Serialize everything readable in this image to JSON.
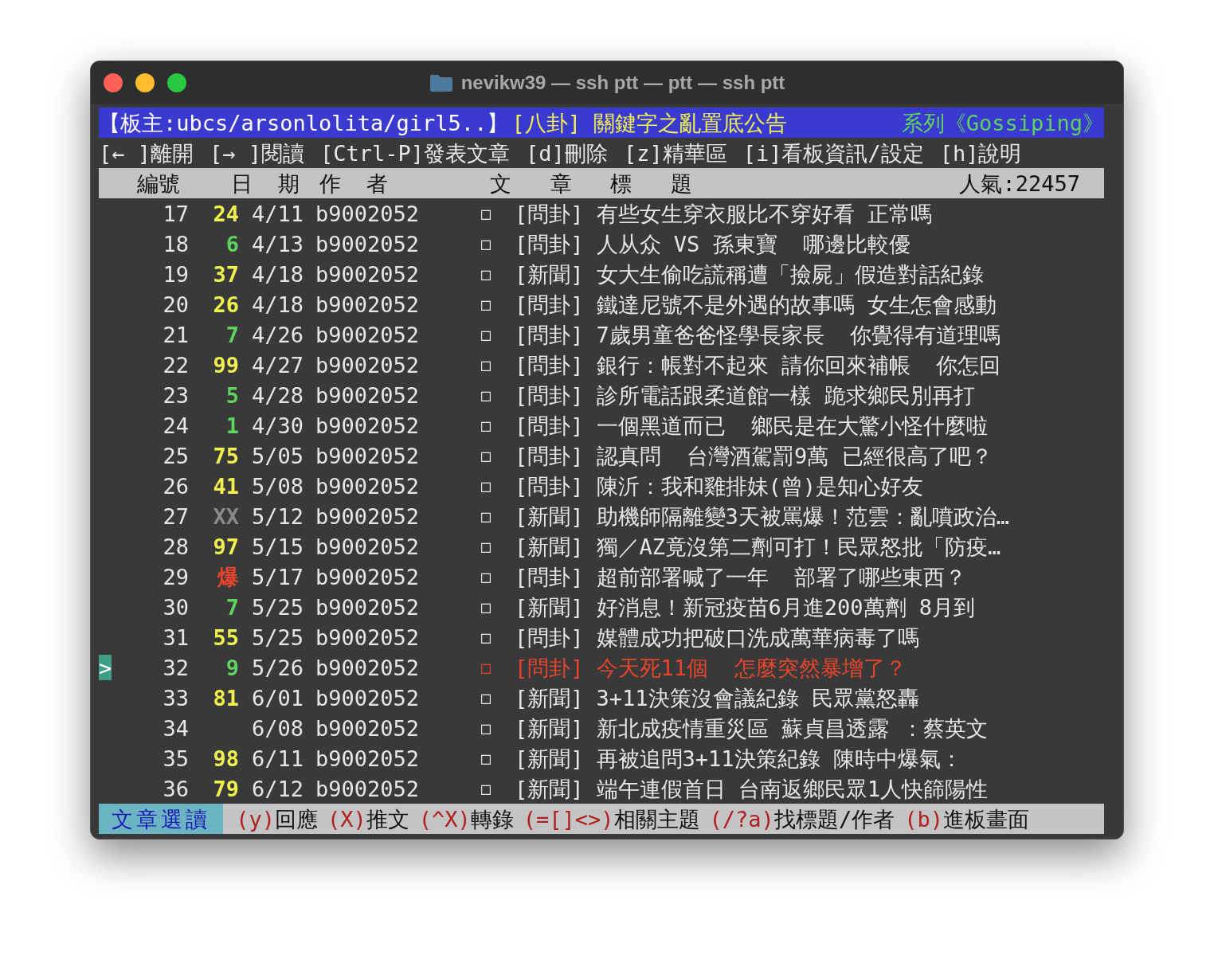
{
  "window": {
    "title": "nevikw39 — ssh ptt — ptt — ssh ptt"
  },
  "board_header": {
    "moderator": "【板主:ubcs/arsonlolita/girl5..】",
    "notice": "[八卦] 關鍵字之亂置底公告",
    "series": "系列《Gossiping》"
  },
  "menu": [
    "[← ]離開",
    "[→ ]閱讀",
    "[Ctrl-P]發表文章",
    "[d]刪除",
    "[z]精華區",
    "[i]看板資訊/設定",
    "[h]說明"
  ],
  "columns": {
    "number": "編號",
    "date": "日 期",
    "author": "作 者",
    "title": "文 章 標 題",
    "popularity": "人氣:22457"
  },
  "rows": [
    {
      "number": "17",
      "push": "24",
      "color": "#f0f050",
      "date": "4/11",
      "author": "b9002052",
      "mark": "□",
      "category": "[問卦]",
      "title": "有些女生穿衣服比不穿好看 正常嗎",
      "selected": false
    },
    {
      "number": "18",
      "push": "6",
      "color": "#5fd35f",
      "date": "4/13",
      "author": "b9002052",
      "mark": "□",
      "category": "[問卦]",
      "title": "人从众 VS 孫東寶  哪邊比較優",
      "selected": false
    },
    {
      "number": "19",
      "push": "37",
      "color": "#f0f050",
      "date": "4/18",
      "author": "b9002052",
      "mark": "□",
      "category": "[新聞]",
      "title": "女大生偷吃謊稱遭「撿屍」假造對話紀錄",
      "selected": false
    },
    {
      "number": "20",
      "push": "26",
      "color": "#f0f050",
      "date": "4/18",
      "author": "b9002052",
      "mark": "□",
      "category": "[問卦]",
      "title": "鐵達尼號不是外遇的故事嗎 女生怎會感動",
      "selected": false
    },
    {
      "number": "21",
      "push": "7",
      "color": "#5fd35f",
      "date": "4/26",
      "author": "b9002052",
      "mark": "□",
      "category": "[問卦]",
      "title": "7歲男童爸爸怪學長家長  你覺得有道理嗎",
      "selected": false
    },
    {
      "number": "22",
      "push": "99",
      "color": "#f0f050",
      "date": "4/27",
      "author": "b9002052",
      "mark": "□",
      "category": "[問卦]",
      "title": "銀行：帳對不起來 請你回來補帳  你怎回",
      "selected": false
    },
    {
      "number": "23",
      "push": "5",
      "color": "#5fd35f",
      "date": "4/28",
      "author": "b9002052",
      "mark": "□",
      "category": "[問卦]",
      "title": "診所電話跟柔道館一樣 跪求鄉民別再打",
      "selected": false
    },
    {
      "number": "24",
      "push": "1",
      "color": "#5fd35f",
      "date": "4/30",
      "author": "b9002052",
      "mark": "□",
      "category": "[問卦]",
      "title": "一個黑道而已  鄉民是在大驚小怪什麼啦",
      "selected": false
    },
    {
      "number": "25",
      "push": "75",
      "color": "#f0f050",
      "date": "5/05",
      "author": "b9002052",
      "mark": "□",
      "category": "[問卦]",
      "title": "認真問  台灣酒駕罰9萬 已經很高了吧？",
      "selected": false
    },
    {
      "number": "26",
      "push": "41",
      "color": "#f0f050",
      "date": "5/08",
      "author": "b9002052",
      "mark": "□",
      "category": "[問卦]",
      "title": "陳沂：我和雞排妹(曾)是知心好友",
      "selected": false
    },
    {
      "number": "27",
      "push": "XX",
      "color": "#8a8a8a",
      "date": "5/12",
      "author": "b9002052",
      "mark": "□",
      "category": "[新聞]",
      "title": "助機師隔離變3天被罵爆！范雲：亂噴政治…",
      "selected": false
    },
    {
      "number": "28",
      "push": "97",
      "color": "#f0f050",
      "date": "5/15",
      "author": "b9002052",
      "mark": "□",
      "category": "[新聞]",
      "title": "獨／AZ竟沒第二劑可打！民眾怒批「防疫…",
      "selected": false
    },
    {
      "number": "29",
      "push": "爆",
      "color": "#e8452c",
      "date": "5/17",
      "author": "b9002052",
      "mark": "□",
      "category": "[問卦]",
      "title": "超前部署喊了一年  部署了哪些東西？",
      "selected": false
    },
    {
      "number": "30",
      "push": "7",
      "color": "#5fd35f",
      "date": "5/25",
      "author": "b9002052",
      "mark": "□",
      "category": "[新聞]",
      "title": "好消息！新冠疫苗6月進200萬劑 8月到",
      "selected": false
    },
    {
      "number": "31",
      "push": "55",
      "color": "#f0f050",
      "date": "5/25",
      "author": "b9002052",
      "mark": "□",
      "category": "[問卦]",
      "title": "媒體成功把破口洗成萬華病毒了嗎",
      "selected": false
    },
    {
      "number": "32",
      "push": "9",
      "color": "#5fd35f",
      "date": "5/26",
      "author": "b9002052",
      "mark": "□",
      "category": "[問卦]",
      "title": "今天死11個  怎麼突然暴增了？",
      "selected": true,
      "cursor": ">"
    },
    {
      "number": "33",
      "push": "81",
      "color": "#f0f050",
      "date": "6/01",
      "author": "b9002052",
      "mark": "□",
      "category": "[新聞]",
      "title": "3+11決策沒會議紀錄 民眾黨怒轟",
      "selected": false
    },
    {
      "number": "34",
      "date": "6/08",
      "author": "b9002052",
      "mark": "□",
      "category": "[新聞]",
      "title": "新北成疫情重災區 蘇貞昌透露 ：蔡英文",
      "selected": false
    },
    {
      "number": "35",
      "push": "98",
      "color": "#f0f050",
      "date": "6/11",
      "author": "b9002052",
      "mark": "□",
      "category": "[新聞]",
      "title": "再被追問3+11決策紀錄 陳時中爆氣：",
      "selected": false
    },
    {
      "number": "36",
      "push": "79",
      "color": "#f0f050",
      "date": "6/12",
      "author": "b9002052",
      "mark": "□",
      "category": "[新聞]",
      "title": "端午連假首日 台南返鄉民眾1人快篩陽性",
      "selected": false
    }
  ],
  "footer": {
    "mode": "文章選讀",
    "commands": [
      {
        "key": "(y)",
        "label": "回應"
      },
      {
        "key": "(X)",
        "label": "推文"
      },
      {
        "key": "(^X)",
        "label": "轉錄"
      },
      {
        "key": "(=[]<>)",
        "label": "相關主題"
      },
      {
        "key": "(/?a)",
        "label": "找標題/作者"
      },
      {
        "key": "(b)",
        "label": "進板畫面"
      }
    ]
  }
}
